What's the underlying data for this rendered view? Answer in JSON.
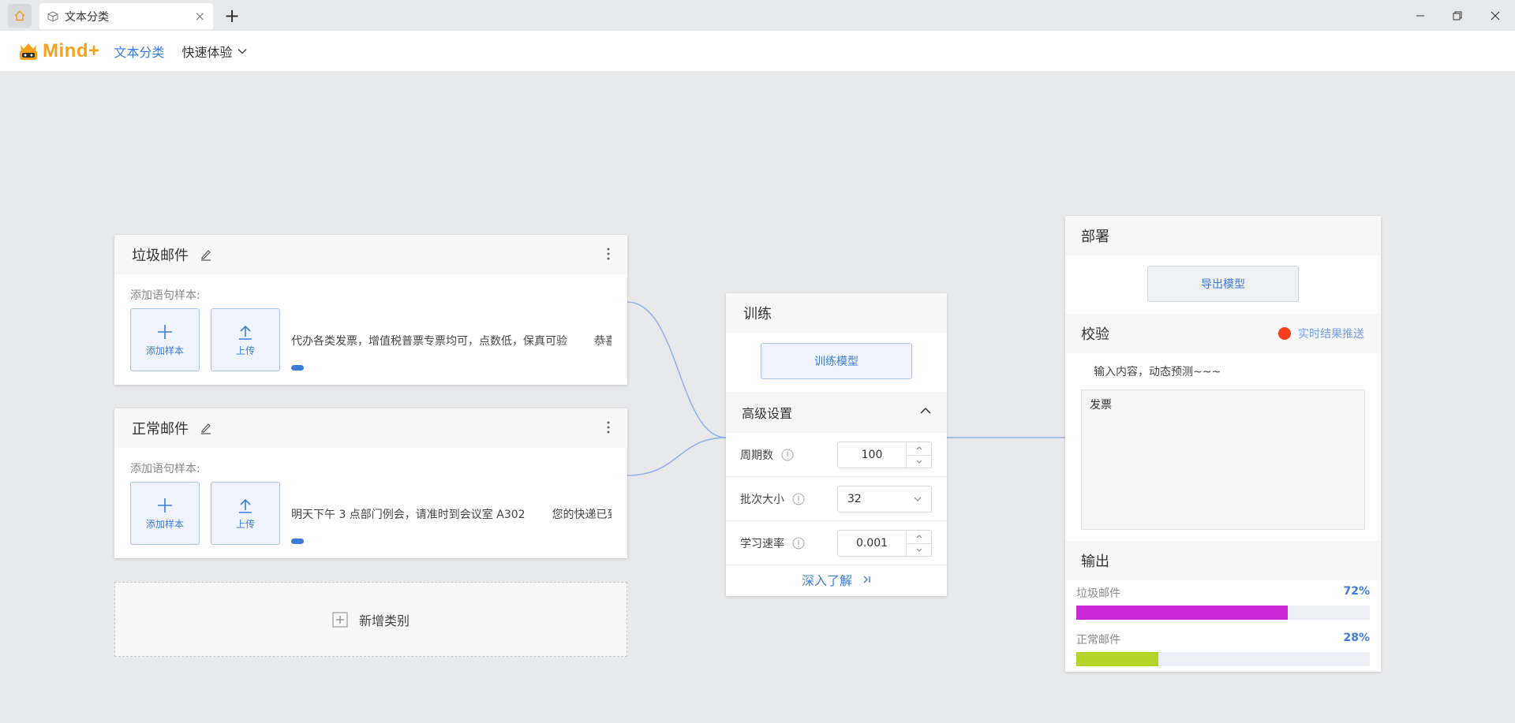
{
  "window": {
    "tab_title": "文本分类",
    "new_tab": "+",
    "controls": [
      "minimize",
      "restore",
      "close"
    ]
  },
  "menubar": {
    "logo_text": "Mind+",
    "active_item": "文本分类",
    "quick_experience": "快速体验"
  },
  "classes": [
    {
      "name": "垃圾邮件",
      "sample_label": "添加语句样本:",
      "add_label": "添加样本",
      "upload_label": "上传",
      "samples": [
        "代办各类发票，增值税普票专票均可，点数低，保真可验",
        "恭喜"
      ]
    },
    {
      "name": "正常邮件",
      "sample_label": "添加语句样本:",
      "add_label": "添加样本",
      "upload_label": "上传",
      "samples": [
        "明天下午 3 点部门例会，请准时到会议室 A302",
        "您的快递已到"
      ]
    }
  ],
  "add_class": {
    "label": "新增类别"
  },
  "training": {
    "title": "训练",
    "train_button": "训练模型",
    "advanced_title": "高级设置",
    "params": {
      "epochs": {
        "label": "周期数",
        "value": "100"
      },
      "batch": {
        "label": "批次大小",
        "value": "32"
      },
      "lr": {
        "label": "学习速率",
        "value": "0.001"
      }
    },
    "learn_more": "深入了解"
  },
  "deploy": {
    "title": "部署",
    "export_button": "导出模型",
    "verify_title": "校验",
    "realtime_label": "实时结果推送",
    "hint": "输入内容，动态预测~~~",
    "input_value": "发票",
    "output_title": "输出",
    "results": [
      {
        "label": "垃圾邮件",
        "percent": "72%",
        "value": 0.72,
        "color": "#c928d6"
      },
      {
        "label": "正常邮件",
        "percent": "28%",
        "value": 0.28,
        "color": "#b4d42a"
      }
    ]
  },
  "colors": {
    "accent": "#3b7ddd",
    "logo": "#f7a21a",
    "realtime_dot": "#f53f1d"
  }
}
